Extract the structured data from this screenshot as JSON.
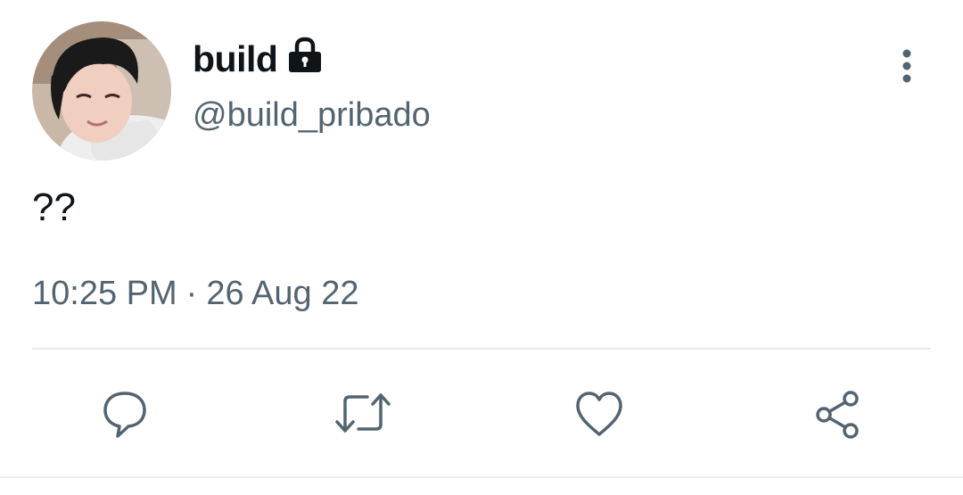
{
  "tweet": {
    "author": {
      "display_name": "build",
      "handle": "@build_pribado",
      "avatar_icon": "avatar-photo",
      "protected_icon": "lock-icon"
    },
    "text": "??",
    "meta": {
      "time": "10:25 PM",
      "separator": "·",
      "date": "26 Aug 22"
    },
    "actions": [
      {
        "name": "reply",
        "icon": "comment-icon"
      },
      {
        "name": "retweet",
        "icon": "retweet-icon"
      },
      {
        "name": "like",
        "icon": "heart-icon"
      },
      {
        "name": "share",
        "icon": "share-icon"
      }
    ],
    "menu_icon": "more-vertical-icon"
  },
  "colors": {
    "text_primary": "#0f1419",
    "text_secondary": "#536471",
    "icon": "#536471",
    "divider": "#e7eaee",
    "background": "#ffffff"
  }
}
